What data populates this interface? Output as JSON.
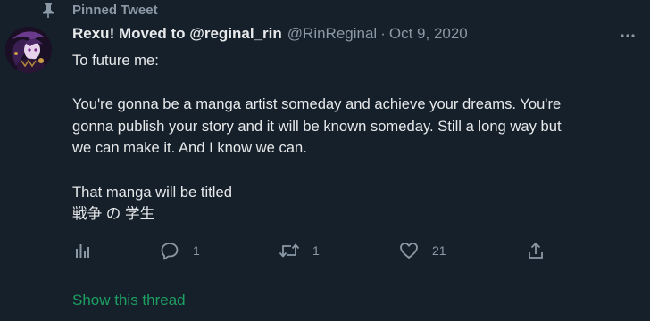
{
  "pinned": {
    "label": "Pinned Tweet"
  },
  "author": {
    "display_name": "Rexu! Moved to @reginal_rin",
    "handle": "@RinReginal",
    "separator": "·",
    "date": "Oct 9, 2020"
  },
  "body": {
    "line1": "To future me:",
    "para2": "You're gonna be a manga artist someday and achieve your dreams. You're\ngonna publish your story and it will be known someday. Still a long way but\nwe can make it. And I know we can.",
    "para3_line1": "That manga will be titled",
    "para3_line2": "戦争 の 学生"
  },
  "actions": {
    "analytics": {
      "icon": "analytics-icon"
    },
    "reply": {
      "icon": "reply-icon",
      "count": "1"
    },
    "retweet": {
      "icon": "retweet-icon",
      "count": "1"
    },
    "like": {
      "icon": "heart-icon",
      "count": "21"
    },
    "share": {
      "icon": "share-icon"
    }
  },
  "show_thread": "Show this thread",
  "colors": {
    "background": "#15202b",
    "text": "#e7e9ea",
    "muted": "#8b98a5",
    "link": "#1d9f61"
  }
}
